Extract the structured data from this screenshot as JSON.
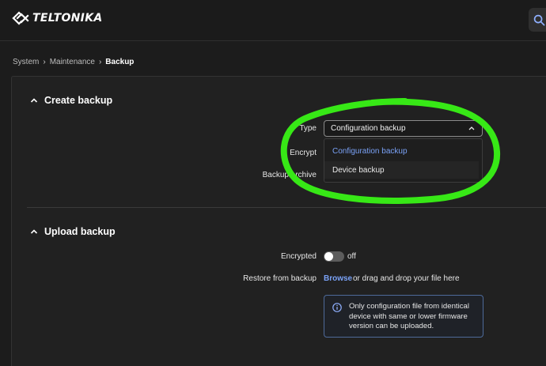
{
  "brand": {
    "name": "TELTONIKA"
  },
  "header": {
    "search_icon": "search-icon"
  },
  "breadcrumb": {
    "items": [
      "System",
      "Maintenance"
    ],
    "current": "Backup"
  },
  "create_backup": {
    "title": "Create backup",
    "type_label": "Type",
    "type_value": "Configuration backup",
    "type_options": [
      "Configuration backup",
      "Device backup"
    ],
    "encrypt_label": "Encrypt",
    "archive_label": "Backup archive"
  },
  "upload_backup": {
    "title": "Upload backup",
    "encrypted_label": "Encrypted",
    "encrypted_state": "off",
    "restore_label": "Restore from backup",
    "browse_label": "Browse",
    "drag_text": "or drag and drop your file here",
    "info_text": "Only configuration file from identical device with same or lower firmware version can be uploaded."
  },
  "colors": {
    "accent": "#7aa2f7",
    "annotation": "#37e816",
    "background": "#1c1c1c"
  }
}
